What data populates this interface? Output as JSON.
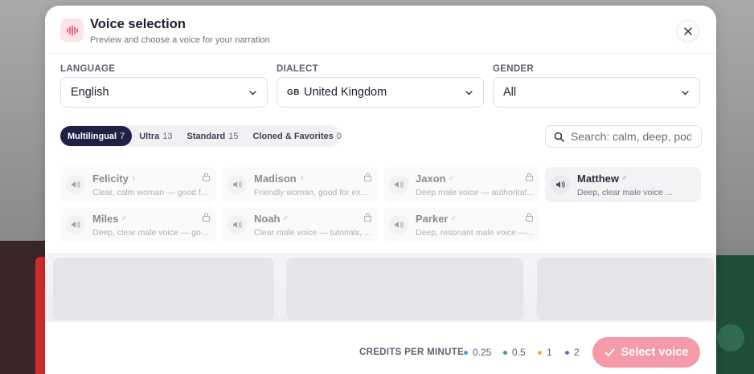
{
  "modal": {
    "title": "Voice selection",
    "subtitle": "Preview and choose a voice for your narration"
  },
  "filters": {
    "language": {
      "label": "LANGUAGE",
      "value": "English"
    },
    "dialect": {
      "label": "DIALECT",
      "flag_code": "GB",
      "value": "United Kingdom"
    },
    "gender": {
      "label": "GENDER",
      "value": "All"
    }
  },
  "tabs": [
    {
      "label": "Multilingual",
      "count": "7",
      "active": true
    },
    {
      "label": "Ultra",
      "count": "13",
      "active": false
    },
    {
      "label": "Standard",
      "count": "15",
      "active": false
    },
    {
      "label": "Cloned & Favorites",
      "count": "0",
      "active": false
    }
  ],
  "search": {
    "placeholder": "Search: calm, deep, podcast"
  },
  "voices": [
    {
      "name": "Felicity",
      "gender_symbol": "♀",
      "description": "Clear, calm woman — good f...",
      "locked": true,
      "selected": false
    },
    {
      "name": "Madison",
      "gender_symbol": "♀",
      "description": "Friendly woman, good for ex...",
      "locked": true,
      "selected": false
    },
    {
      "name": "Jaxon",
      "gender_symbol": "♂",
      "description": "Deep male voice — authoritat...",
      "locked": true,
      "selected": false
    },
    {
      "name": "Matthew",
      "gender_symbol": "♂",
      "description": "Deep, clear male voice ...",
      "locked": false,
      "selected": true
    },
    {
      "name": "Miles",
      "gender_symbol": "♂",
      "description": "Deep, clear male voice — goo...",
      "locked": true,
      "selected": false
    },
    {
      "name": "Noah",
      "gender_symbol": "♂",
      "description": "Clear male voice — tutorials, ...",
      "locked": true,
      "selected": false
    },
    {
      "name": "Parker",
      "gender_symbol": "♂",
      "description": "Deep, resonant male voice —...",
      "locked": true,
      "selected": false
    }
  ],
  "footer": {
    "credits_label": "CREDITS PER MINUTE",
    "credits": [
      {
        "value": "0.25",
        "color": "#3b9ee0"
      },
      {
        "value": "0.5",
        "color": "#3aa857"
      },
      {
        "value": "1",
        "color": "#f0b429"
      },
      {
        "value": "2",
        "color": "#8a57c9"
      }
    ],
    "select_button": "Select voice"
  },
  "colors": {
    "accent": "#f49aa8",
    "tab_active": "#1e2146",
    "logo_bg": "#fde4ea",
    "logo_icon": "#e8496a"
  }
}
